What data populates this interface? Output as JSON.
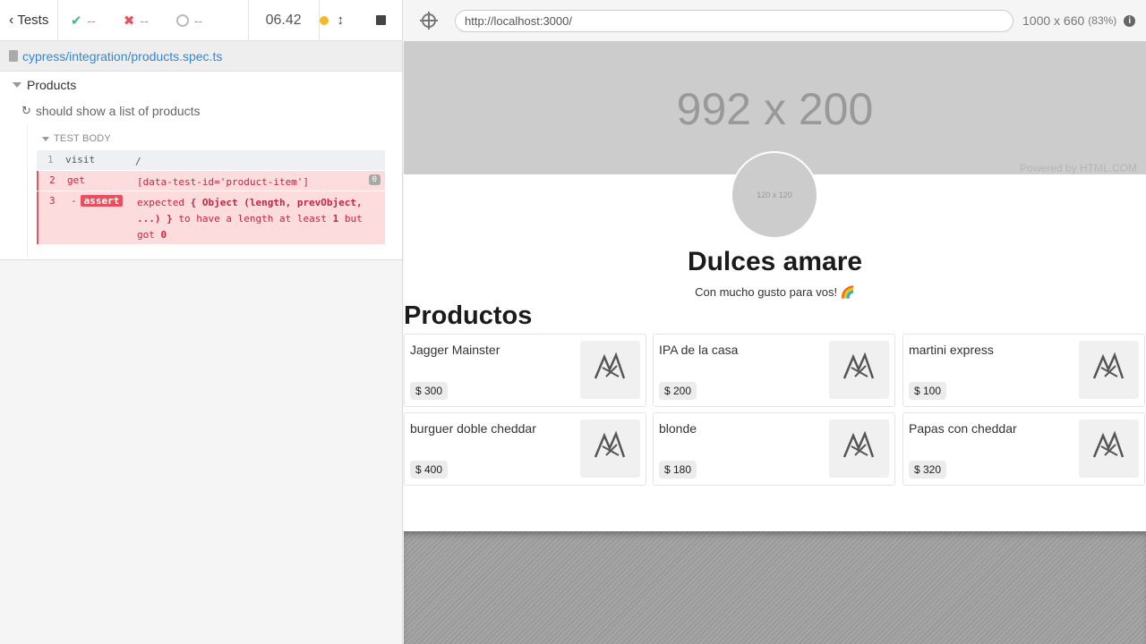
{
  "reporter": {
    "header": {
      "back_label": "Tests",
      "passed": "--",
      "failed": "--",
      "pending": "--",
      "duration": "06.42"
    },
    "spec_path": "cypress/integration/products.spec.ts",
    "suite_title": "Products",
    "test_title": "should show a list of products",
    "test_body_label": "TEST BODY",
    "commands": [
      {
        "num": "1",
        "name": "visit",
        "message": "/"
      },
      {
        "num": "2",
        "name": "get",
        "message": "[data-test-id='product-item']",
        "badge": "0"
      },
      {
        "num": "3",
        "prefix": "-",
        "name": "assert",
        "msg_expected": "expected",
        "msg_object": "{ Object (length, prevObject, ...) }",
        "msg_to_have": "to have a length at least",
        "msg_one": "1",
        "msg_but": "but got",
        "msg_zero": "0"
      }
    ]
  },
  "aut": {
    "url": "http://localhost:3000/",
    "viewport": "1000 x 660",
    "scale": "(83%)",
    "info_icon": "i",
    "banner_text": "992 x 200",
    "banner_powered": "Powered by HTML.COM",
    "avatar_text": "120 x 120",
    "shop_name": "Dulces amare",
    "shop_subtitle": "Con mucho gusto para vos! 🌈",
    "section_title": "Productos",
    "products": [
      {
        "name": "Jagger Mainster",
        "price": "$ 300"
      },
      {
        "name": "IPA de la casa",
        "price": "$ 200"
      },
      {
        "name": "martini express",
        "price": "$ 100"
      },
      {
        "name": "burguer doble cheddar",
        "price": "$ 400"
      },
      {
        "name": "blonde",
        "price": "$ 180"
      },
      {
        "name": "Papas con cheddar",
        "price": "$ 320"
      }
    ]
  },
  "colors": {
    "pass": "#3fbb7c",
    "fail": "#e94f5f",
    "link": "#3386d4",
    "running": "#f6b924"
  }
}
